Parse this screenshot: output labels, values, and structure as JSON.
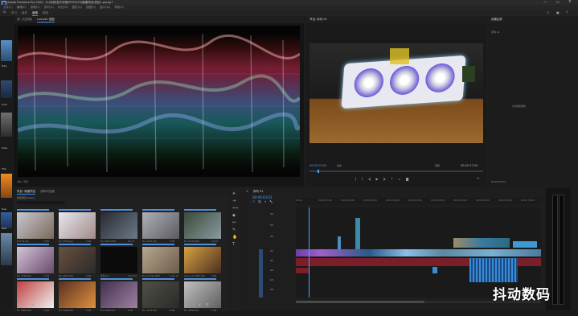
{
  "app": {
    "title": "Adobe Premiere Pro 2020 - D:\\评测\\显卡评测\\RTX3070\\新建项目\\项目1.prproj *",
    "menus": [
      "文件(F)",
      "编辑(E)",
      "剪辑(C)",
      "序列(S)",
      "标记(M)",
      "图形(G)",
      "视图(V)",
      "窗口(W)",
      "帮助(H)"
    ],
    "workspace_tabs": [
      "学习",
      "组件",
      "编辑",
      "颜色",
      "效果",
      "音频",
      "图形",
      "库"
    ],
    "workspace_active": 2
  },
  "source_panel": {
    "tabs": [
      "源: (无剪辑)",
      "Lumetri 范围"
    ],
    "active_tab": 1,
    "footer": "8位  ▾  浮点"
  },
  "program_panel": {
    "title": "节目: 序列 01",
    "timecode": "00:00:03:03",
    "fit": "适合",
    "quality": "完整",
    "duration": "00:02:37:04"
  },
  "right_panel": {
    "tab": "效果控件",
    "sub": "序列 01",
    "empty_msg": "(未选择剪辑)",
    "footer_tc": "00:00:03:03"
  },
  "project_panel": {
    "tabs": [
      "项目: 新建项目",
      "媒体浏览器"
    ],
    "path": "新建项目.prproj",
    "items": [
      {
        "name": "D1234.JPG",
        "dur": "5:00",
        "c1": "#c8c8d0",
        "c2": "#7a6a5a",
        "barw": 40
      },
      {
        "name": "D1_3008.jpg",
        "dur": "5:00",
        "c1": "#e8e8ee",
        "c2": "#a08a8a",
        "barw": 40
      },
      {
        "name": "D1 ASUS.MP4",
        "dur": "45:11",
        "c1": "#2a2a30",
        "c2": "#6a7a8a",
        "barw": 40
      },
      {
        "name": "D1 ASUS.JPG",
        "dur": "5:00",
        "c1": "#b0b0b8",
        "c2": "#5a5a60",
        "barw": 40
      },
      {
        "name": "D3 ASUS.MP4",
        "dur": "12:03",
        "c1": "#3a4a3a",
        "c2": "#8a9aa0",
        "barw": 40
      },
      {
        "name": "D1_5789.JPG",
        "dur": "5:00",
        "c1": "#d4c4d8",
        "c2": "#6a4a6a",
        "barw": 40
      },
      {
        "name": "D1_2891.JPG",
        "dur": "5:00",
        "c1": "#6a5040",
        "c2": "#2a2a2a",
        "barw": 40
      },
      {
        "name": "序列 01",
        "dur": "2:37:04",
        "c1": "#0b0b0b",
        "c2": "#0b0b0b",
        "barw": 40
      },
      {
        "name": "Final Video.MP4",
        "dur": "1:12:10",
        "c1": "#b8a890",
        "c2": "#6a5a4a",
        "barw": 40
      },
      {
        "name": "Conn 10_3820.JPG",
        "dur": "5:00",
        "c1": "#d8a040",
        "c2": "#4a3020",
        "barw": 40
      },
      {
        "name": "D1_3812.JPG",
        "dur": "5:00",
        "c1": "#c04040",
        "c2": "#f0f0f0",
        "barw": 40
      },
      {
        "name": "D1_4420.JPG",
        "dur": "5:00",
        "c1": "#5a3020",
        "c2": "#e09040",
        "barw": 40
      },
      {
        "name": "D1_4560.JPG",
        "dur": "5:00",
        "c1": "#403050",
        "c2": "#a080a0",
        "barw": 40
      },
      {
        "name": "D1_4512.JPG",
        "dur": "5:00",
        "c1": "#505048",
        "c2": "#2a2a28",
        "barw": 40
      },
      {
        "name": "D1_4600.JPG",
        "dur": "5:00",
        "c1": "#c0c0c0",
        "c2": "#606060",
        "barw": 40
      }
    ]
  },
  "left_strip": {
    "labels": [
      "Tran",
      "Com",
      "Crea",
      "The",
      "Ove",
      "Skill"
    ]
  },
  "timeline": {
    "tab": "序列 01",
    "timecode": "00:00:03:03",
    "ruler": [
      "00:00",
      "00:00:15:00",
      "00:00:30:00",
      "00:00:45:00",
      "00:01:00:00",
      "00:01:15:00",
      "00:01:30:00",
      "00:01:45:00",
      "00:02:00:00",
      "00:02:15:00",
      "00:02:30:00"
    ],
    "tracks": [
      "V4",
      "V3",
      "V2",
      "V1",
      "A1",
      "A2",
      "A3",
      "A4"
    ],
    "accent": "#2d8ceb"
  },
  "watermark": "抖动数码"
}
